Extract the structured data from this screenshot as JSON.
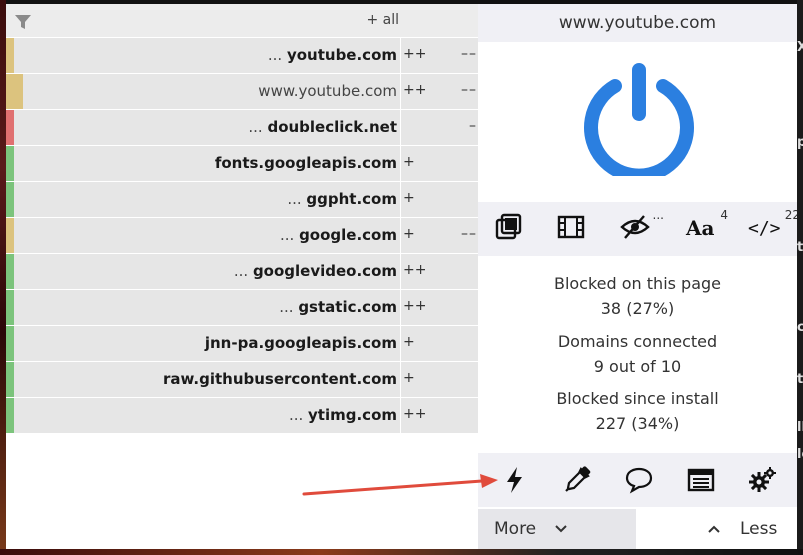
{
  "colors": {
    "accent": "#2b7fe0",
    "panel_bg": "#f0f0f5",
    "row_bg": "#e6e6e6",
    "arrow": "#e04b3c"
  },
  "firewall": {
    "header_label": "+ all",
    "rows": [
      {
        "prefix": "... ",
        "domain": "youtube.com",
        "bold": true,
        "col1": "++",
        "col2": "––",
        "color": "#dcc37e"
      },
      {
        "prefix": "",
        "domain": "www.youtube.com",
        "bold": false,
        "col1": "++",
        "col2": "––",
        "color": "#dcc37e"
      },
      {
        "prefix": "... ",
        "domain": "doubleclick.net",
        "bold": true,
        "col1": "",
        "col2": "–",
        "color": "#e07070"
      },
      {
        "prefix": "",
        "domain": "fonts.googleapis.com",
        "bold": true,
        "col1": "+",
        "col2": "",
        "color": "#7cc47c"
      },
      {
        "prefix": "... ",
        "domain": "ggpht.com",
        "bold": true,
        "col1": "+",
        "col2": "",
        "color": "#7cc47c"
      },
      {
        "prefix": "... ",
        "domain": "google.com",
        "bold": true,
        "col1": "+",
        "col2": "––",
        "color": "#dcc37e"
      },
      {
        "prefix": "... ",
        "domain": "googlevideo.com",
        "bold": true,
        "col1": "++",
        "col2": "",
        "color": "#7cc47c"
      },
      {
        "prefix": "... ",
        "domain": "gstatic.com",
        "bold": true,
        "col1": "++",
        "col2": "",
        "color": "#7cc47c"
      },
      {
        "prefix": "",
        "domain": "jnn-pa.googleapis.com",
        "bold": true,
        "col1": "+",
        "col2": "",
        "color": "#7cc47c"
      },
      {
        "prefix": "",
        "domain": "raw.githubusercontent.com",
        "bold": true,
        "col1": "+",
        "col2": "",
        "color": "#7cc47c"
      },
      {
        "prefix": "... ",
        "domain": "ytimg.com",
        "bold": true,
        "col1": "++",
        "col2": "",
        "color": "#7cc47c"
      }
    ]
  },
  "panel": {
    "hostname": "www.youtube.com",
    "tools": [
      {
        "icon": "popup-block-icon",
        "badge": ""
      },
      {
        "icon": "media-block-icon",
        "badge": ""
      },
      {
        "icon": "cosmetic-filter-icon",
        "badge": "..."
      },
      {
        "icon": "remote-font-icon",
        "badge": "4"
      },
      {
        "icon": "javascript-icon",
        "badge": "22"
      }
    ],
    "stats": {
      "blocked_page_label": "Blocked on this page",
      "blocked_page_value": "38 (27%)",
      "domains_label": "Domains connected",
      "domains_value": "9 out of 10",
      "blocked_install_label": "Blocked since install",
      "blocked_install_value": "227 (34%)"
    },
    "actions": [
      "zapper-icon",
      "picker-icon",
      "report-icon",
      "logger-icon",
      "settings-icon"
    ],
    "more_label": "More",
    "less_label": "Less"
  },
  "background": {
    "glyphs": [
      "X",
      "p",
      "t",
      "c",
      "t",
      "ll",
      "le"
    ]
  }
}
